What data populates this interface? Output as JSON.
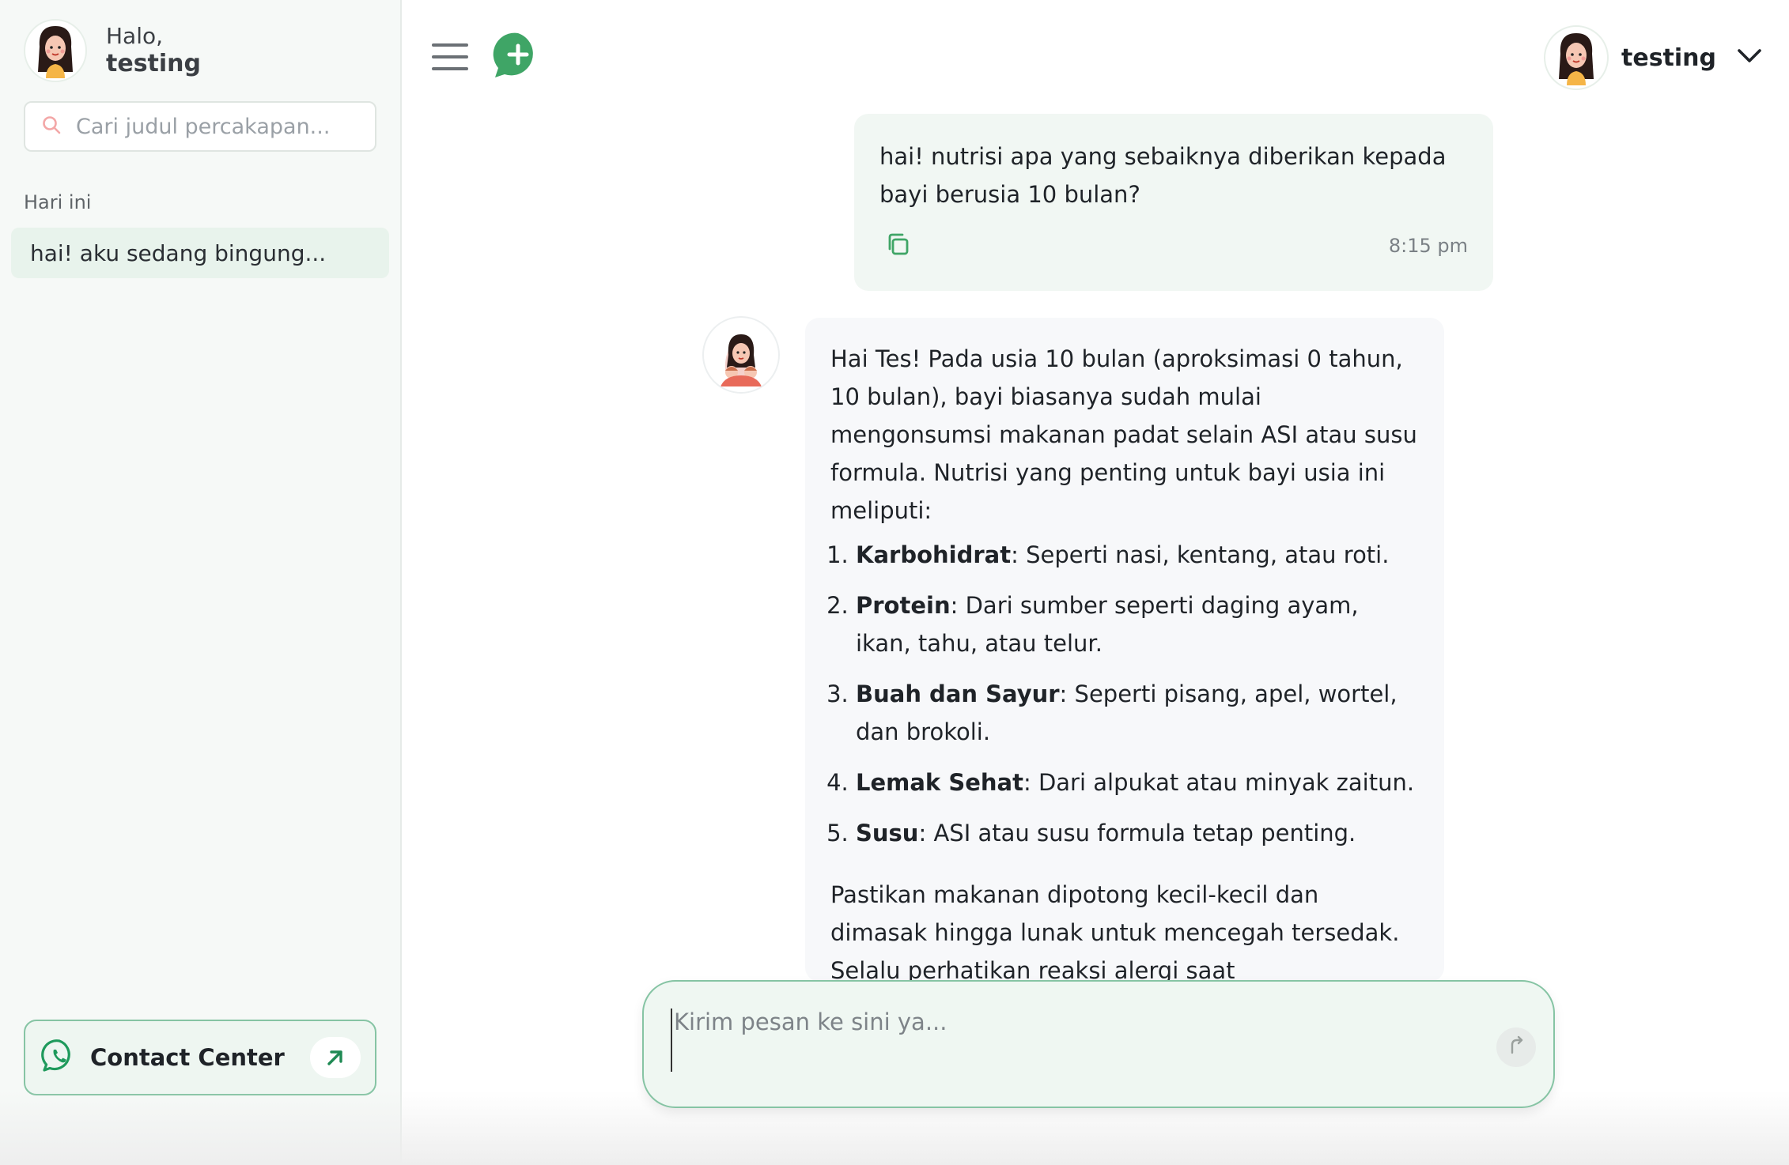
{
  "sidebar": {
    "greeting_hello": "Halo,",
    "greeting_name": "testing",
    "search_placeholder": "Cari judul percakapan...",
    "section_label": "Hari ini",
    "conversations": [
      {
        "title": "hai! aku sedang bingung..."
      }
    ],
    "contact_label": "Contact Center"
  },
  "header": {
    "user_name": "testing"
  },
  "chat": {
    "user_message": {
      "text": "hai! nutrisi apa yang sebaiknya diberikan kepada bayi berusia 10 bulan?",
      "time": "8:15 pm"
    },
    "bot_message": {
      "intro": "Hai Tes! Pada usia 10 bulan (aproksimasi 0 tahun, 10 bulan), bayi biasanya sudah mulai mengonsumsi makanan padat selain ASI atau susu formula. Nutrisi yang penting untuk bayi usia ini meliputi:",
      "items": [
        {
          "term": "Karbohidrat",
          "desc": ": Seperti nasi, kentang, atau roti."
        },
        {
          "term": "Protein",
          "desc": ": Dari sumber seperti daging ayam, ikan, tahu, atau telur."
        },
        {
          "term": "Buah dan Sayur",
          "desc": ": Seperti pisang, apel, wortel, dan brokoli."
        },
        {
          "term": "Lemak Sehat",
          "desc": ": Dari alpukat atau minyak zaitun."
        },
        {
          "term": "Susu",
          "desc": ": ASI atau susu formula tetap penting."
        }
      ],
      "closing": "Pastikan makanan dipotong kecil-kecil dan dimasak hingga lunak untuk mencegah tersedak. Selalu perhatikan reaksi alergi saat memperkenalkan makanan baru. Apakah ada yang ingin kamu"
    }
  },
  "composer": {
    "placeholder": "Kirim pesan ke sini ya..."
  },
  "colors": {
    "accent_green": "#3fa566",
    "border_green": "#86c4a4",
    "sidebar_bg": "#f6f9f7",
    "active_item_bg": "#e8f3ec",
    "user_bubble_bg": "#f1f7f3",
    "bot_bubble_bg": "#f7f8fa"
  },
  "icons": {
    "search": "search-icon",
    "menu": "hamburger-menu-icon",
    "new_chat": "new-chat-plus-icon",
    "chevron": "chevron-down-icon",
    "copy": "copy-icon",
    "whatsapp": "whatsapp-icon",
    "external": "arrow-up-right-icon",
    "send": "send-icon"
  }
}
